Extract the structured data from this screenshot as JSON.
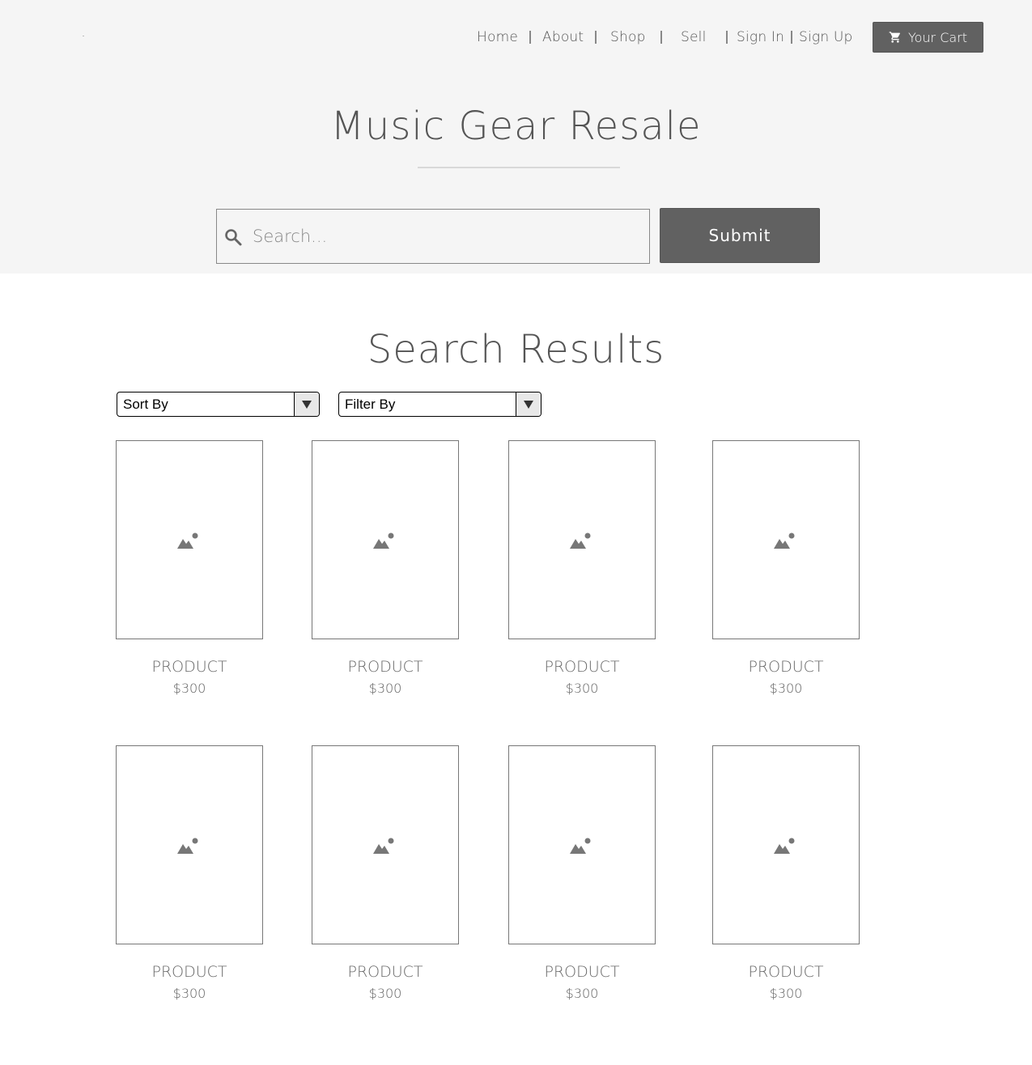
{
  "nav": {
    "items": [
      {
        "label": "Home"
      },
      {
        "label": "About"
      },
      {
        "label": "Shop"
      },
      {
        "label": "Sell"
      },
      {
        "label": "Sign In"
      },
      {
        "label": "Sign Up"
      }
    ],
    "cart_label": "Your Cart",
    "cart_icon": "shopping-cart-icon"
  },
  "header": {
    "title": "Music Gear Resale"
  },
  "search": {
    "placeholder": "Search...",
    "value": "",
    "icon": "search-icon",
    "submit_label": "Submit"
  },
  "results": {
    "title": "Search Results",
    "sort_label": "Sort By",
    "filter_label": "Filter By",
    "products": [
      {
        "name": "PRODUCT",
        "price": "$300"
      },
      {
        "name": "PRODUCT",
        "price": "$300"
      },
      {
        "name": "PRODUCT",
        "price": "$300"
      },
      {
        "name": "PRODUCT",
        "price": "$300"
      },
      {
        "name": "PRODUCT",
        "price": "$300"
      },
      {
        "name": "PRODUCT",
        "price": "$300"
      },
      {
        "name": "PRODUCT",
        "price": "$300"
      },
      {
        "name": "PRODUCT",
        "price": "$300"
      }
    ]
  },
  "colors": {
    "header_bg": "#f5f5f5",
    "button_bg": "#616161",
    "text": "#555555"
  }
}
